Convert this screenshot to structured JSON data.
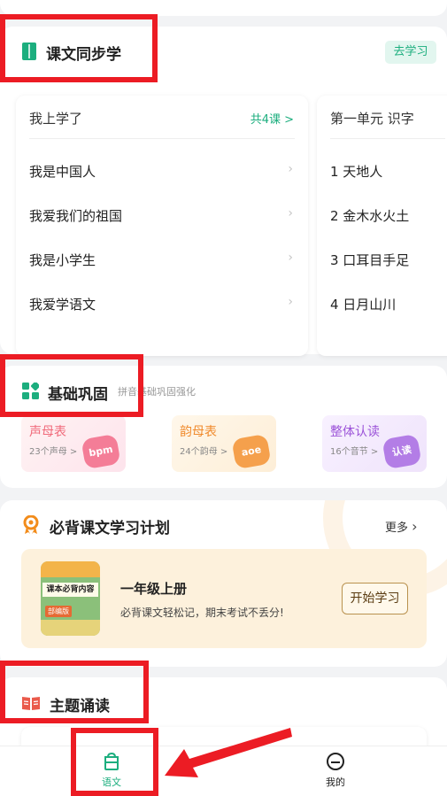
{
  "sync": {
    "title": "课文同步学",
    "go_button": "去学习",
    "learned_panel": {
      "header": "我上学了",
      "more": "共4课 >",
      "items": [
        "我是中国人",
        "我爱我们的祖国",
        "我是小学生",
        "我爱学语文"
      ]
    },
    "unit_panel": {
      "header": "第一单元 识字",
      "items": [
        "1 天地人",
        "2 金木水火土",
        "3 口耳目手足",
        "4 日月山川"
      ]
    }
  },
  "basic": {
    "title": "基础巩固",
    "subtitle": "拼音基础巩固强化",
    "tiles": [
      {
        "title": "声母表",
        "sub": "23个声母 >",
        "badge": "bpm"
      },
      {
        "title": "韵母表",
        "sub": "24个韵母 >",
        "badge": "aoe"
      },
      {
        "title": "整体认读",
        "sub": "16个音节 >",
        "badge": "认读"
      }
    ]
  },
  "plan": {
    "title": "必背课文学习计划",
    "more": "更多",
    "book_title": "课本必背内容",
    "book_tag": "部编版",
    "grade": "一年级上册",
    "description": "必背课文轻松记，期末考试不丢分!",
    "start_button": "开始学习"
  },
  "theme": {
    "title": "主题诵读"
  },
  "tabbar": {
    "tabs": [
      {
        "label": "语文",
        "icon": "textbook-bag-icon",
        "active": true
      },
      {
        "label": "我的",
        "icon": "smiley-face-icon",
        "active": false
      }
    ]
  },
  "colors": {
    "accent": "#1cae7e",
    "highlight_box": "#ec1c24",
    "shengmu": "#f06a7a",
    "yunmu": "#f08a2c",
    "zhengti": "#9b52d8"
  }
}
